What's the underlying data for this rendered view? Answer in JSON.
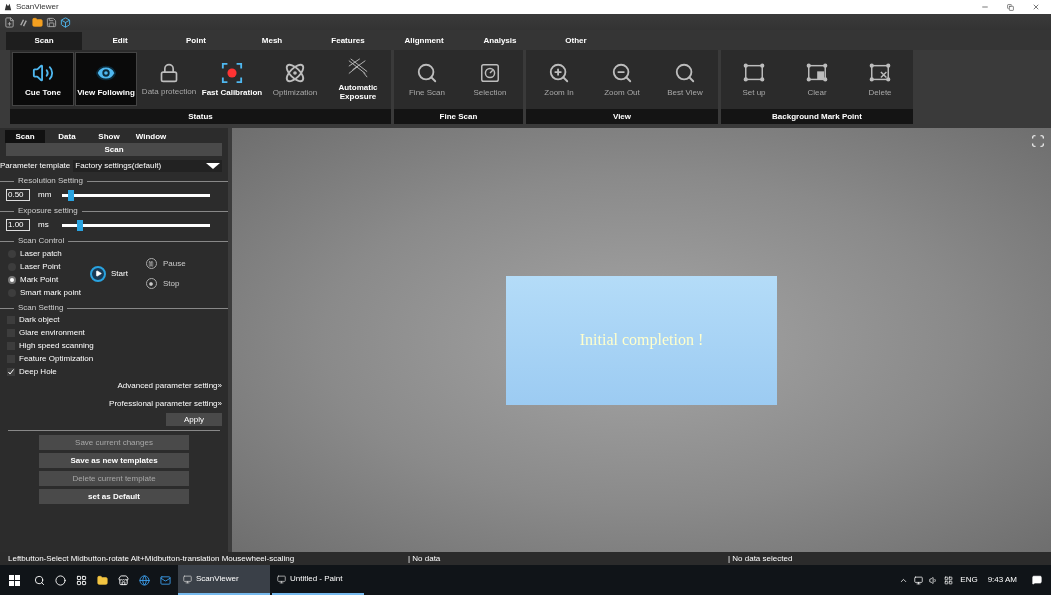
{
  "window": {
    "title": "ScanViewer"
  },
  "ribbon_tabs": [
    {
      "label": "Scan",
      "selected": true
    },
    {
      "label": "Edit",
      "selected": false
    },
    {
      "label": "Point",
      "selected": false
    },
    {
      "label": "Mesh",
      "selected": false
    },
    {
      "label": "Features",
      "selected": false
    },
    {
      "label": "Alignment",
      "selected": false
    },
    {
      "label": "Analysis",
      "selected": false
    },
    {
      "label": "Other",
      "selected": false
    }
  ],
  "ribbon_groups": [
    {
      "title": "Status",
      "buttons": [
        {
          "label": "Cue Tone",
          "pressed": true,
          "disabled": false
        },
        {
          "label": "View Following",
          "pressed": true,
          "disabled": false
        },
        {
          "label": "Data protection",
          "pressed": false,
          "disabled": true
        },
        {
          "label": "Fast Calibration",
          "pressed": false,
          "disabled": false
        },
        {
          "label": "Optimization",
          "pressed": false,
          "disabled": true
        },
        {
          "label": "Automatic Exposure",
          "pressed": false,
          "disabled": false
        }
      ]
    },
    {
      "title": "Fine Scan",
      "buttons": [
        {
          "label": "Fine Scan",
          "pressed": false,
          "disabled": true
        },
        {
          "label": "Selection",
          "pressed": false,
          "disabled": true
        }
      ]
    },
    {
      "title": "View",
      "buttons": [
        {
          "label": "Zoom In",
          "pressed": false,
          "disabled": true
        },
        {
          "label": "Zoom Out",
          "pressed": false,
          "disabled": true
        },
        {
          "label": "Best View",
          "pressed": false,
          "disabled": true
        }
      ]
    },
    {
      "title": "Background Mark Point",
      "buttons": [
        {
          "label": "Set up",
          "pressed": false,
          "disabled": true
        },
        {
          "label": "Clear",
          "pressed": false,
          "disabled": true
        },
        {
          "label": "Delete",
          "pressed": false,
          "disabled": true
        }
      ]
    }
  ],
  "panel": {
    "tabs": [
      {
        "label": "Scan",
        "selected": true
      },
      {
        "label": "Data",
        "selected": false
      },
      {
        "label": "Show",
        "selected": false
      },
      {
        "label": "Window",
        "selected": false
      }
    ],
    "header": "Scan",
    "template": {
      "label": "Parameter template",
      "value": "Factory settings(default)"
    },
    "resolution": {
      "title": "Resolution Setting",
      "value": "0.50",
      "unit": "mm",
      "level": 0.06
    },
    "exposure": {
      "title": "Exposure setting",
      "value": "1.00",
      "unit": "ms",
      "level": 0.12
    },
    "scan_control": {
      "title": "Scan Control",
      "modes": [
        {
          "label": "Laser patch",
          "selected": false
        },
        {
          "label": "Laser Point",
          "selected": false
        },
        {
          "label": "Mark Point",
          "selected": true
        },
        {
          "label": "Smart mark point",
          "selected": false
        }
      ],
      "start": "Start",
      "pause": "Pause",
      "stop": "Stop"
    },
    "scan_setting": {
      "title": "Scan Setting",
      "options": [
        {
          "label": "Dark object",
          "checked": false
        },
        {
          "label": "Glare environment",
          "checked": false
        },
        {
          "label": "High speed scanning",
          "checked": false
        },
        {
          "label": "Feature Optimization",
          "checked": false
        },
        {
          "label": "Deep Hole",
          "checked": true
        }
      ],
      "advanced": "Advanced parameter setting»",
      "professional": "Professional parameter setting»",
      "apply": "Apply"
    },
    "template_buttons": [
      {
        "label": "Save current changes",
        "disabled": true
      },
      {
        "label": "Save as new templates",
        "disabled": false
      },
      {
        "label": "Delete current template",
        "disabled": true
      },
      {
        "label": "set as Default",
        "disabled": false
      }
    ]
  },
  "canvas": {
    "message": "Initial completion !"
  },
  "status_bar": [
    "Leftbutton-Select Midbutton-rotate Alt+Midbutton-translation Mousewheel-scaling",
    "| No data",
    "| No data selected"
  ],
  "taskbar": {
    "apps": [
      {
        "label": "ScanViewer",
        "selected": true
      },
      {
        "label": "Untitled - Paint",
        "selected": false
      }
    ],
    "language": "ENG",
    "time": "9:43 AM"
  }
}
